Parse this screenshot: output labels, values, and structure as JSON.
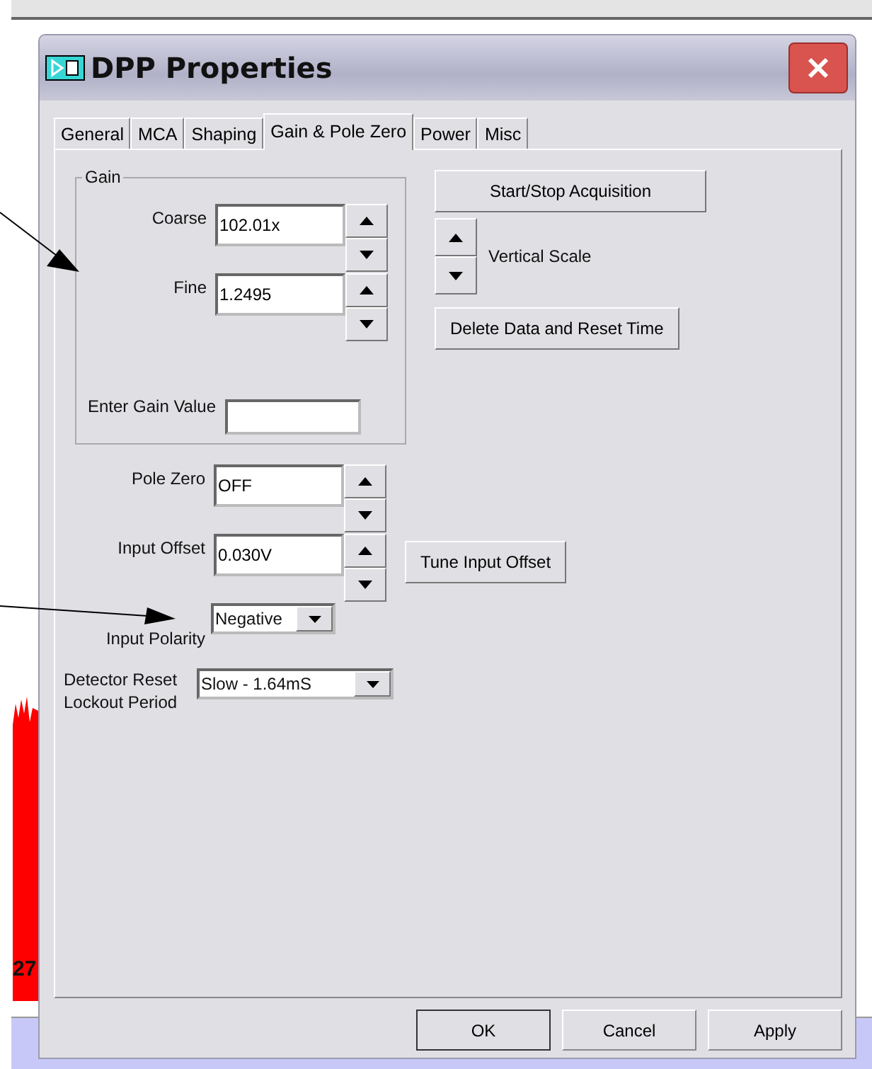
{
  "window": {
    "title": "DPP Properties"
  },
  "tabs": [
    {
      "label": "General",
      "selected": false
    },
    {
      "label": "MCA",
      "selected": false
    },
    {
      "label": "Shaping",
      "selected": false
    },
    {
      "label": "Gain & Pole Zero",
      "selected": true
    },
    {
      "label": "Power",
      "selected": false
    },
    {
      "label": "Misc",
      "selected": false
    }
  ],
  "gain_group": {
    "title": "Gain",
    "fields": [
      {
        "label": "Coarse",
        "value": "102.01x"
      },
      {
        "label": "Fine",
        "value": "1.2495"
      }
    ],
    "entry_label": "Enter Gain Value"
  },
  "actions": {
    "start_stop": "Start/Stop Acquisition",
    "vertical_scale": "Vertical Scale",
    "delete_reset": "Delete Data and Reset Time"
  },
  "pole_zero": {
    "label": "Pole Zero",
    "value": "OFF"
  },
  "input_offset": {
    "label": "Input Offset",
    "value": "0.030V",
    "button": "Tune Input Offset"
  },
  "input_polarity": {
    "label": "Input Polarity",
    "value": "Negative"
  },
  "reset_lockout": {
    "label": "Detector Reset Lockout Period",
    "value": "Slow - 1.64mS"
  },
  "buttons": [
    {
      "label": "OK",
      "default": true
    },
    {
      "label": "Cancel",
      "default": false
    },
    {
      "label": "Apply",
      "default": false
    }
  ],
  "background": {
    "chart_label": "27"
  }
}
